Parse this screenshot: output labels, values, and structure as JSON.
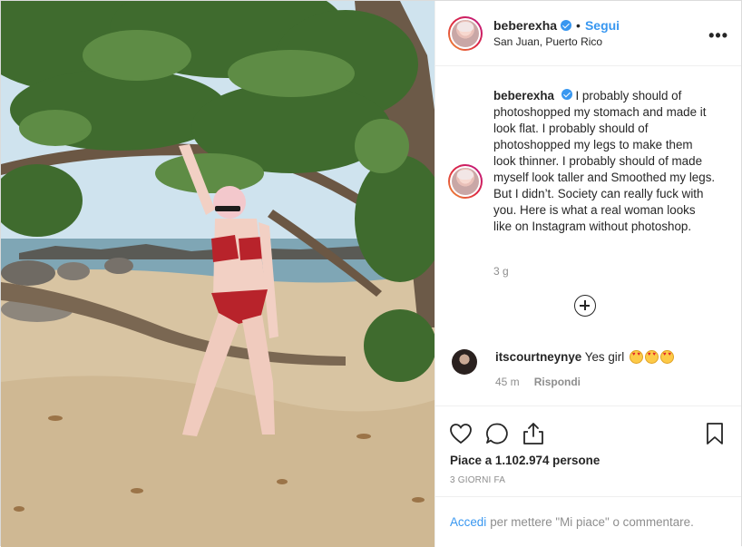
{
  "header": {
    "username": "beberexha",
    "separator": "•",
    "follow_label": "Segui",
    "location": "San Juan, Puerto Rico",
    "more_label": "•••"
  },
  "caption": {
    "username": "beberexha",
    "text": "I probably should of photoshopped my stomach and made it look flat. I probably should of photoshopped my legs to make them look thinner. I probably should of made myself look taller and Smoothed my legs. But I didn’t. Society can really fuck with you. Here is what a real woman looks like on Instagram without photoshop.",
    "time": "3 g"
  },
  "comments": [
    {
      "username": "itscourtneynye",
      "text": "Yes girl",
      "emoji_count": 3,
      "time": "45 m",
      "reply_label": "Rispondi"
    }
  ],
  "actions": {
    "likes": "Piace a 1.102.974 persone",
    "posted_ago": "3 GIORNI FA",
    "icons": [
      "heart-icon",
      "comment-icon",
      "share-icon",
      "bookmark-icon"
    ]
  },
  "login": {
    "link": "Accedi",
    "rest": "per mettere \"Mi piace\" o commentare."
  },
  "colors": {
    "link_blue": "#3897f0",
    "text": "#262626",
    "muted": "#8e8e8e",
    "border": "#efefef"
  }
}
